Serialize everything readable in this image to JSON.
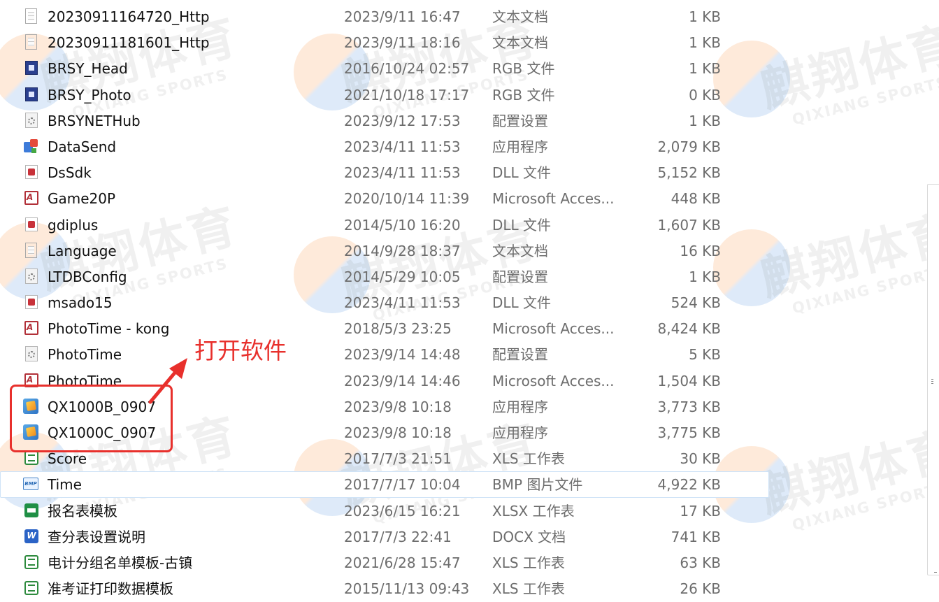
{
  "watermark": {
    "cn": "麒翔体育",
    "en": "QIXIANG SPORTS"
  },
  "files": [
    {
      "name": "20230911164720_Http",
      "date": "2023/9/11 16:47",
      "type": "文本文档",
      "size": "1 KB",
      "icon": "text-file-icon"
    },
    {
      "name": "20230911181601_Http",
      "date": "2023/9/11 18:16",
      "type": "文本文档",
      "size": "1 KB",
      "icon": "text-file-icon"
    },
    {
      "name": "BRSY_Head",
      "date": "2016/10/24 02:57",
      "type": "RGB 文件",
      "size": "1 KB",
      "icon": "rgb-file-icon"
    },
    {
      "name": "BRSY_Photo",
      "date": "2021/10/18 17:17",
      "type": "RGB 文件",
      "size": "0 KB",
      "icon": "rgb-file-icon"
    },
    {
      "name": "BRSYNETHub",
      "date": "2023/9/12 17:53",
      "type": "配置设置",
      "size": "1 KB",
      "icon": "config-file-icon"
    },
    {
      "name": "DataSend",
      "date": "2023/4/11 11:53",
      "type": "应用程序",
      "size": "2,079 KB",
      "icon": "application-icon"
    },
    {
      "name": "DsSdk",
      "date": "2023/4/11 11:53",
      "type": "DLL 文件",
      "size": "5,152 KB",
      "icon": "dll-file-icon"
    },
    {
      "name": "Game20P",
      "date": "2020/10/14 11:39",
      "type": "Microsoft Acces...",
      "size": "448 KB",
      "icon": "access-db-icon"
    },
    {
      "name": "gdiplus",
      "date": "2014/5/10 16:20",
      "type": "DLL 文件",
      "size": "1,607 KB",
      "icon": "dll-file-icon"
    },
    {
      "name": "Language",
      "date": "2014/9/28 18:37",
      "type": "文本文档",
      "size": "16 KB",
      "icon": "text-file-icon"
    },
    {
      "name": "LTDBConfig",
      "date": "2014/5/29 10:05",
      "type": "配置设置",
      "size": "1 KB",
      "icon": "config-file-icon"
    },
    {
      "name": "msado15",
      "date": "2023/4/11 11:53",
      "type": "DLL 文件",
      "size": "524 KB",
      "icon": "dll-file-icon"
    },
    {
      "name": "PhotoTime - kong",
      "date": "2018/5/3 23:25",
      "type": "Microsoft Acces...",
      "size": "8,424 KB",
      "icon": "access-db-icon"
    },
    {
      "name": "PhotoTime",
      "date": "2023/9/14 14:48",
      "type": "配置设置",
      "size": "5 KB",
      "icon": "config-file-icon"
    },
    {
      "name": "PhotoTime",
      "date": "2023/9/14 14:46",
      "type": "Microsoft Acces...",
      "size": "1,504 KB",
      "icon": "access-db-icon"
    },
    {
      "name": "QX1000B_0907",
      "date": "2023/9/8 10:18",
      "type": "应用程序",
      "size": "3,773 KB",
      "icon": "qx-app-icon"
    },
    {
      "name": "QX1000C_0907",
      "date": "2023/9/8 10:18",
      "type": "应用程序",
      "size": "3,775 KB",
      "icon": "qx-app-icon"
    },
    {
      "name": "Score",
      "date": "2017/7/3 21:51",
      "type": "XLS 工作表",
      "size": "30 KB",
      "icon": "xls-file-icon"
    },
    {
      "name": "Time",
      "date": "2017/7/17 10:04",
      "type": "BMP 图片文件",
      "size": "4,922 KB",
      "icon": "bmp-file-icon",
      "hover": true
    },
    {
      "name": "报名表模板",
      "date": "2023/6/15 16:21",
      "type": "XLSX 工作表",
      "size": "17 KB",
      "icon": "xlsx-file-icon"
    },
    {
      "name": "查分表设置说明",
      "date": "2017/7/3 22:41",
      "type": "DOCX 文档",
      "size": "741 KB",
      "icon": "docx-file-icon"
    },
    {
      "name": "电计分组名单模板-古镇",
      "date": "2021/6/28 15:47",
      "type": "XLS 工作表",
      "size": "63 KB",
      "icon": "xls-file-icon"
    },
    {
      "name": "准考证打印数据模板",
      "date": "2015/11/13 09:43",
      "type": "XLS 工作表",
      "size": "26 KB",
      "icon": "xls-file-icon"
    }
  ],
  "annotation": {
    "text": "打开软件",
    "color": "#e8302c"
  },
  "colors": {
    "secondary_text": "#6d6d6d",
    "hover_border": "#cfe3f7"
  }
}
